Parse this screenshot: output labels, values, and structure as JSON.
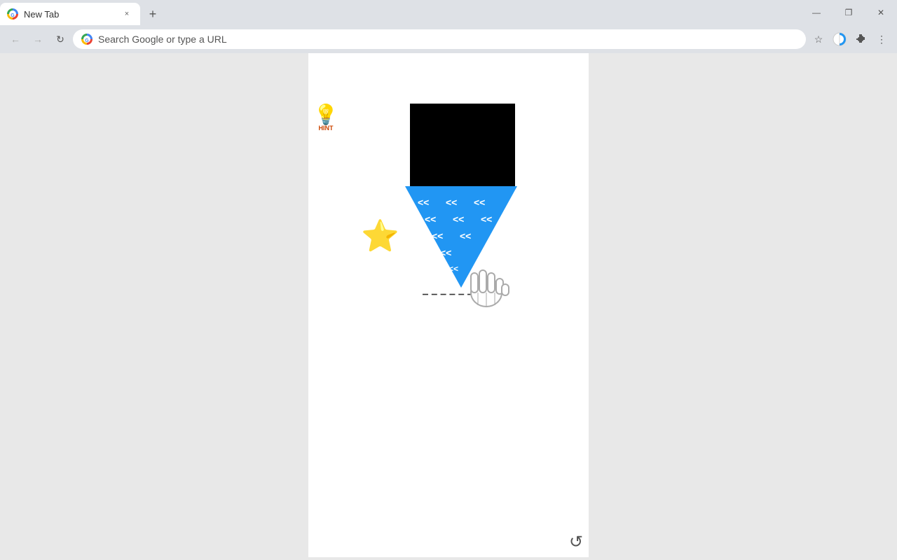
{
  "browser": {
    "tab": {
      "title": "New Tab",
      "close_label": "×",
      "favicon": "G"
    },
    "new_tab_button": "+",
    "window_controls": {
      "minimize": "—",
      "maximize": "❐",
      "close": "✕"
    },
    "address_bar": {
      "back": "←",
      "forward": "→",
      "reload": "↻",
      "placeholder": "Search Google or type a URL",
      "star": "☆",
      "profile_icon": "◑",
      "extensions": "🧩",
      "menu": "⋮"
    }
  },
  "page": {
    "lightbulb_emoji": "💡",
    "lightbulb_label": "HINT",
    "star_emoji": "⭐",
    "hand_emoji": "🤚",
    "reload_icon": "↺",
    "triangle_color": "#2196F3",
    "black_rect_color": "#000000"
  }
}
